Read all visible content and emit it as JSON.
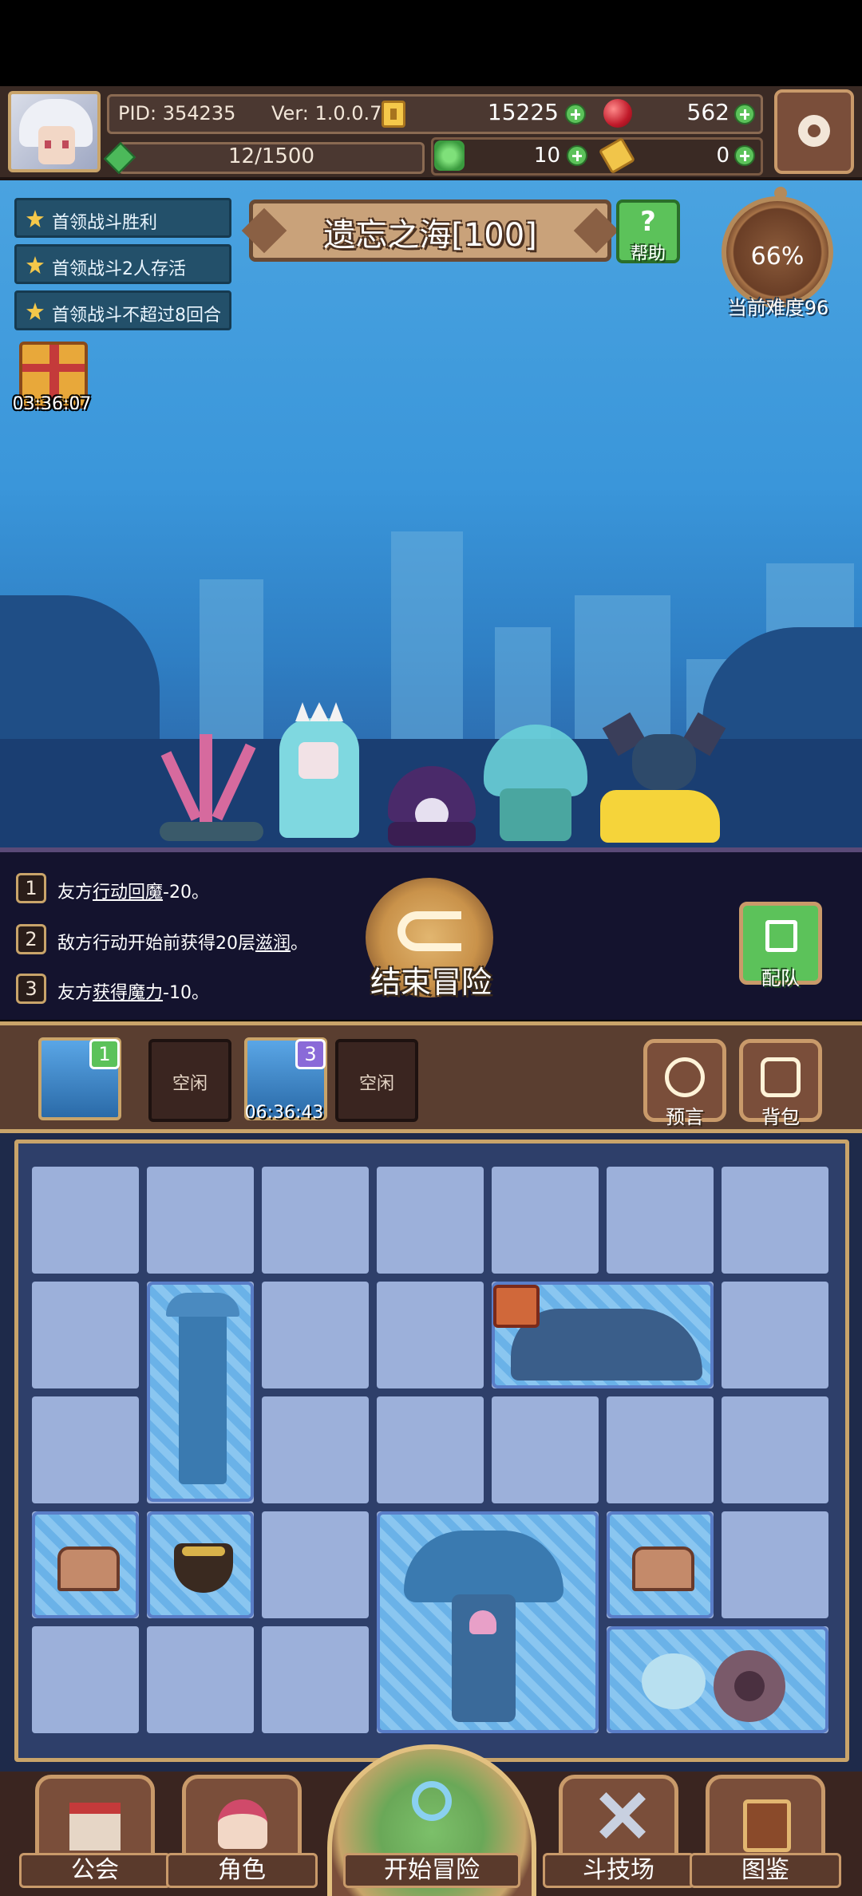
{
  "header": {
    "pid": "PID: 354235",
    "version": "Ver: 1.0.0.7",
    "coins": "15225",
    "gems": "562",
    "stamina": "12/1500",
    "clover": "10",
    "scrolls": "0"
  },
  "quests": [
    "首领战斗胜利",
    "首领战斗2人存活",
    "首领战斗不超过8回合"
  ],
  "gift": {
    "timer": "03:36:07"
  },
  "stage": {
    "title": "遗忘之海[100]",
    "help_label": "帮助"
  },
  "difficulty": {
    "percent": "66%",
    "label": "当前难度96"
  },
  "effects": [
    {
      "num": "1",
      "pre": "友方",
      "link": "行动回魔",
      "post": "-20。"
    },
    {
      "num": "2",
      "pre": "敌方行动开始前获得20层",
      "link": "滋润",
      "post": "。"
    },
    {
      "num": "3",
      "pre": "友方",
      "link": "获得魔力",
      "post": "-10。"
    }
  ],
  "actions": {
    "end_adventure": "结束冒险",
    "team": "配队"
  },
  "slots": {
    "slot1_badge": "1",
    "slot2_label": "空闲",
    "slot3_badge": "3",
    "slot3_timer": "06:36:43",
    "slot4_label": "空闲",
    "prophecy": "预言",
    "bag": "背包"
  },
  "nav": {
    "guild": "公会",
    "role": "角色",
    "start": "开始冒险",
    "arena": "斗技场",
    "codex": "图鉴"
  },
  "colors": {
    "sky": "#4aa3e0",
    "panel": "#14132e",
    "wood": "#7a4e3a",
    "gold_trim": "#c9a46a",
    "board_cell": "#9cb0da",
    "green_button": "#5cc25a"
  }
}
